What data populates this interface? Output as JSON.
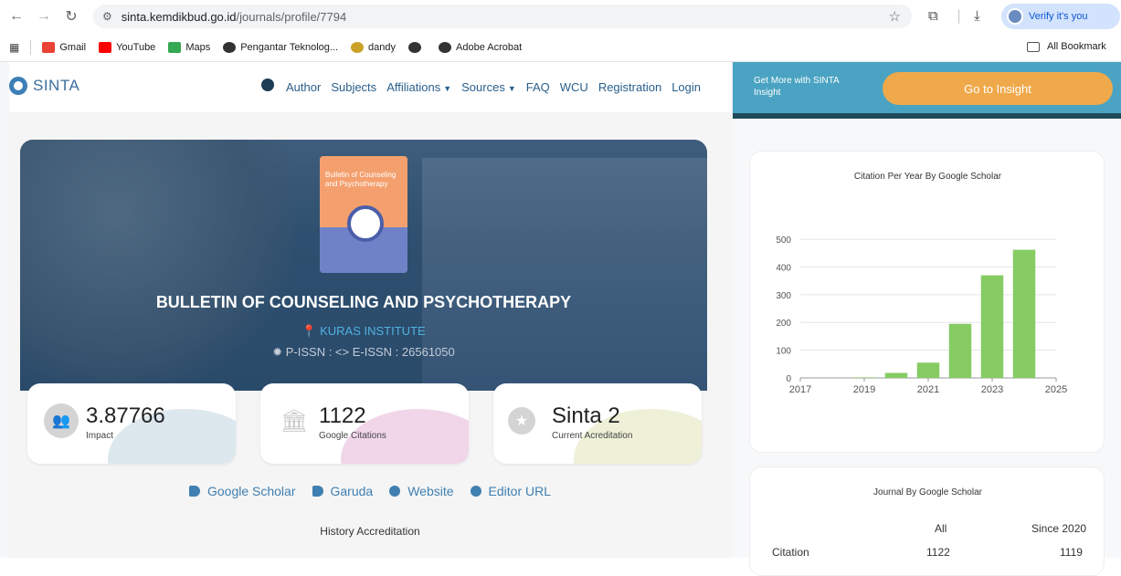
{
  "browser": {
    "url_host": "sinta.kemdikbud.go.id",
    "url_path": "/journals/profile/7794",
    "verify_label": "Verify it's you",
    "bookmarks": [
      {
        "label": "Gmail",
        "color": "#ea4335"
      },
      {
        "label": "YouTube",
        "color": "#ff0000"
      },
      {
        "label": "Maps",
        "color": "#34a853"
      },
      {
        "label": "Pengantar Teknolog...",
        "color": "#333333"
      },
      {
        "label": "dandy",
        "color": "#c9a227"
      },
      {
        "label": "",
        "color": "#333333"
      },
      {
        "label": "Adobe Acrobat",
        "color": "#333333"
      }
    ],
    "all_bookmarks": "All Bookmark"
  },
  "site": {
    "logo": "SINTA",
    "nav": [
      "Author",
      "Subjects",
      "Affiliations",
      "Sources",
      "FAQ",
      "WCU",
      "Registration",
      "Login"
    ],
    "insight_text": "Get More with SINTA Insight",
    "insight_button": "Go to Insight"
  },
  "journal": {
    "cover_title": "Bulletin of Counseling and Psychotherapy",
    "title": "BULLETIN OF COUNSELING AND PSYCHOTHERAPY",
    "institution": "KURAS INSTITUTE",
    "issn": "P-ISSN :  <> E-ISSN : 26561050"
  },
  "stats": [
    {
      "value": "3.87766",
      "label": "Impact",
      "deco": "#dde7ee"
    },
    {
      "value": "1122",
      "label": "Google Citations",
      "deco": "#f1d6ea"
    },
    {
      "value": "Sinta 2",
      "label": "Current Acreditation",
      "deco": "#eef0d8"
    }
  ],
  "links": [
    "Google Scholar",
    "Garuda",
    "Website",
    "Editor URL"
  ],
  "history_label": "History Accreditation",
  "chart_data": {
    "type": "bar",
    "title": "Citation Per Year By Google Scholar",
    "categories": [
      "2017",
      "2018",
      "2019",
      "2020",
      "2021",
      "2022",
      "2023",
      "2024",
      "2025"
    ],
    "values": [
      0,
      0,
      2,
      18,
      55,
      195,
      370,
      462,
      0
    ],
    "x_ticks": [
      "2017",
      "2019",
      "2021",
      "2023",
      "2025"
    ],
    "y_ticks": [
      0,
      100,
      200,
      300,
      400,
      500
    ],
    "ylim": [
      0,
      520
    ],
    "bar_color": "#86cc63",
    "grid": true
  },
  "journal_scholar": {
    "title": "Journal By Google Scholar",
    "col_all": "All",
    "col_since": "Since 2020",
    "row_label": "Citation",
    "row_all": "1122",
    "row_since": "1119"
  }
}
